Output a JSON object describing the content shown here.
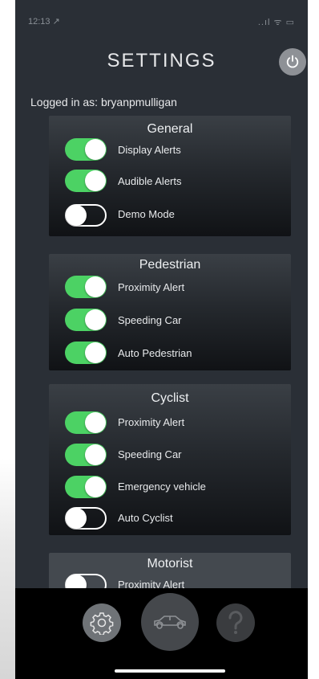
{
  "status_bar": {
    "time": "12:13 ↗",
    "signal": "..ıl ᯤ ▭"
  },
  "header": {
    "title": "SETTINGS"
  },
  "user": {
    "logged_in": "Logged in as: bryanpmulligan"
  },
  "sections": [
    {
      "title": "General",
      "items": [
        {
          "label": "Display Alerts",
          "on": true
        },
        {
          "label": "Audible Alerts",
          "on": true
        },
        {
          "label": "Demo Mode",
          "on": false
        }
      ]
    },
    {
      "title": "Pedestrian",
      "items": [
        {
          "label": "Proximity Alert",
          "on": true
        },
        {
          "label": "Speeding Car",
          "on": true
        },
        {
          "label": "Auto Pedestrian",
          "on": true
        }
      ]
    },
    {
      "title": "Cyclist",
      "items": [
        {
          "label": "Proximity Alert",
          "on": true
        },
        {
          "label": "Speeding Car",
          "on": true
        },
        {
          "label": "Emergency vehicle",
          "on": true
        },
        {
          "label": "Auto Cyclist",
          "on": false
        }
      ]
    },
    {
      "title": "Motorist",
      "items": [
        {
          "label": "Proximity Alert",
          "on": false
        }
      ]
    }
  ],
  "tab_bar": {
    "tabs": [
      {
        "icon": "gear-icon",
        "active": true
      },
      {
        "icon": "car-icon",
        "active": false
      },
      {
        "icon": "question-mark-icon",
        "active": false
      }
    ]
  },
  "colors": {
    "toggle_on": "#4cd264",
    "background": "#2a2f36",
    "tab_bar": "#000000"
  }
}
